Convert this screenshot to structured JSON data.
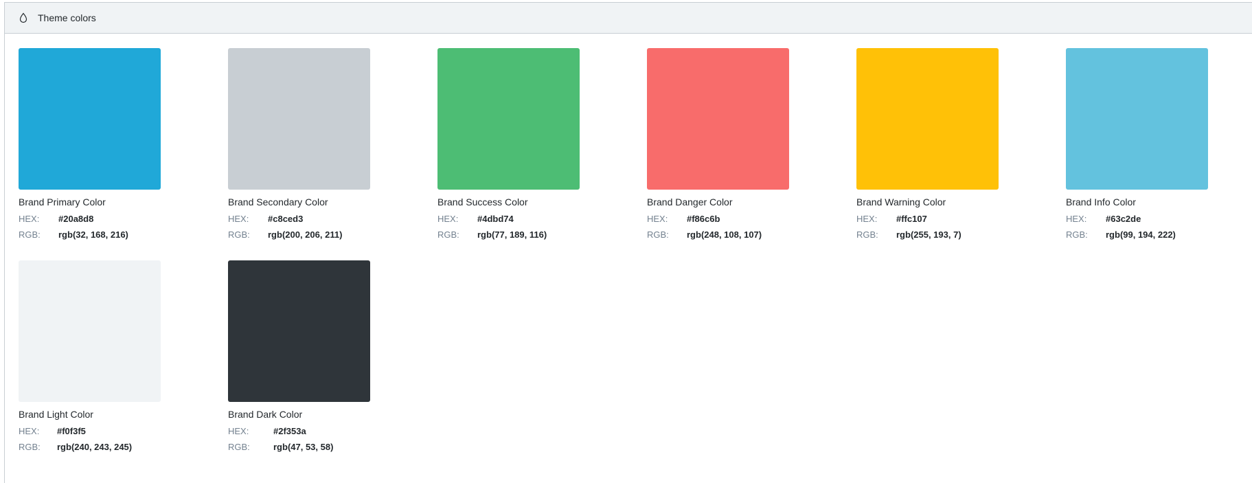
{
  "header": {
    "title": "Theme colors",
    "icon": "drop-icon"
  },
  "labels": {
    "hex": "HEX:",
    "rgb": "RGB:"
  },
  "colors": [
    {
      "name": "Brand Primary Color",
      "hex": "#20a8d8",
      "rgb": "rgb(32, 168, 216)"
    },
    {
      "name": "Brand Secondary Color",
      "hex": "#c8ced3",
      "rgb": "rgb(200, 206, 211)"
    },
    {
      "name": "Brand Success Color",
      "hex": "#4dbd74",
      "rgb": "rgb(77, 189, 116)"
    },
    {
      "name": "Brand Danger Color",
      "hex": "#f86c6b",
      "rgb": "rgb(248, 108, 107)"
    },
    {
      "name": "Brand Warning Color",
      "hex": "#ffc107",
      "rgb": "rgb(255, 193, 7)"
    },
    {
      "name": "Brand Info Color",
      "hex": "#63c2de",
      "rgb": "rgb(99, 194, 222)"
    },
    {
      "name": "Brand Light Color",
      "hex": "#f0f3f5",
      "rgb": "rgb(240, 243, 245)"
    },
    {
      "name": "Brand Dark Color",
      "hex": "#2f353a",
      "rgb": "rgb(47, 53, 58)"
    }
  ]
}
